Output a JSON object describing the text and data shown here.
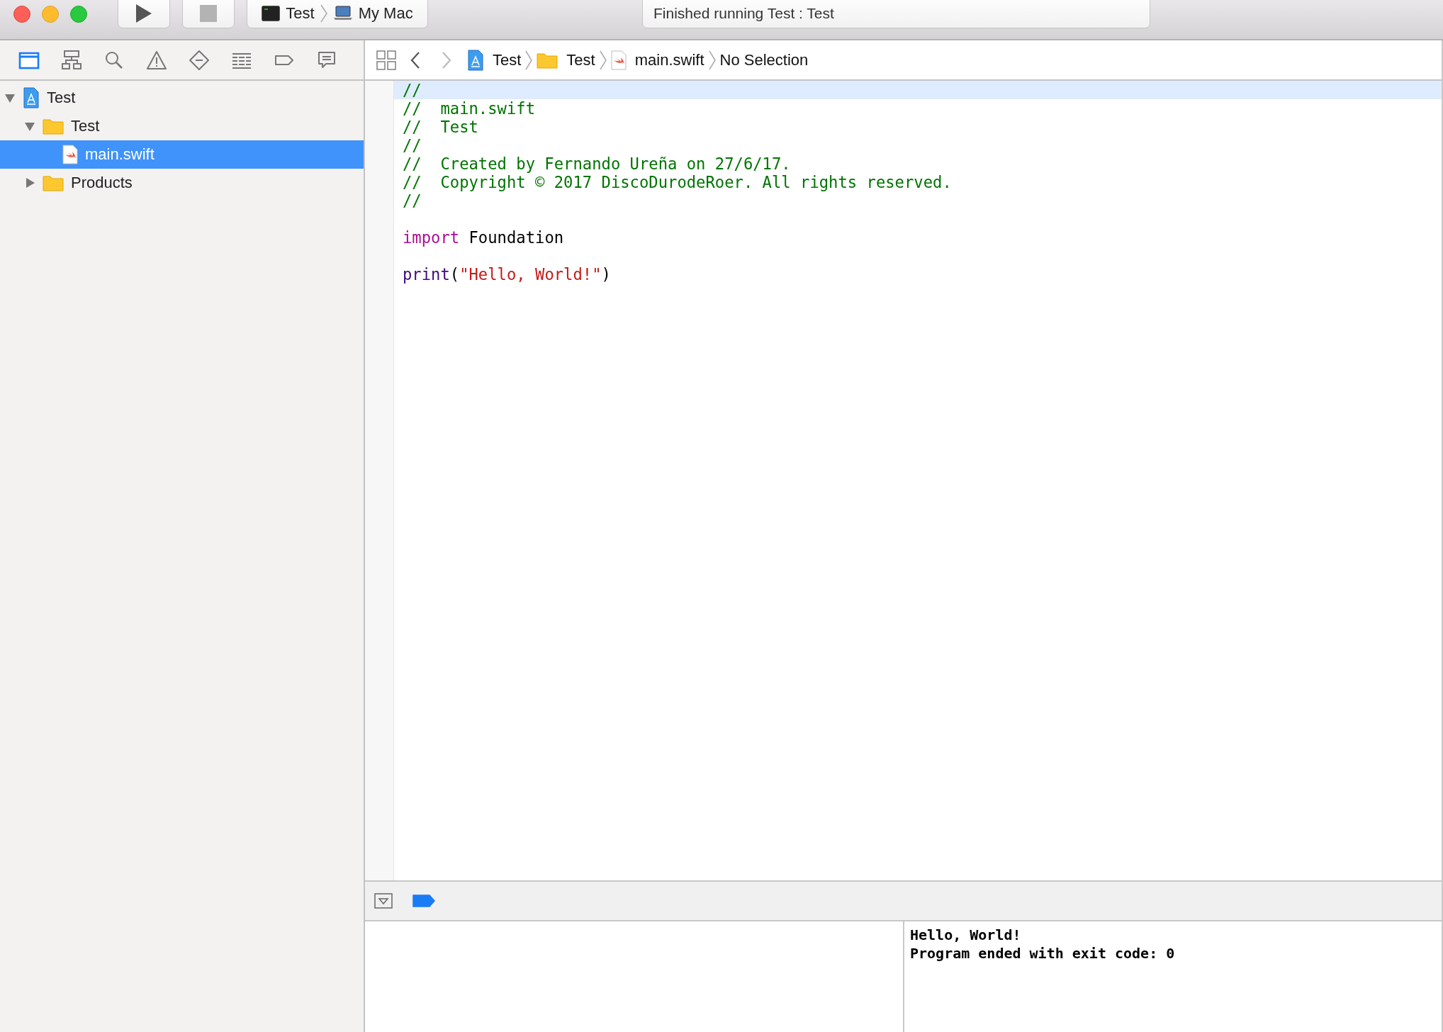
{
  "toolbar": {
    "scheme": {
      "target": "Test",
      "destination": "My Mac"
    },
    "activity": "Finished running Test : Test"
  },
  "navigator": {
    "tabs": [
      {
        "kind": "project",
        "selected": true
      },
      {
        "kind": "symbol",
        "selected": false
      },
      {
        "kind": "find",
        "selected": false
      },
      {
        "kind": "issue",
        "selected": false
      },
      {
        "kind": "test",
        "selected": false
      },
      {
        "kind": "debug",
        "selected": false
      },
      {
        "kind": "breakpoint",
        "selected": false
      },
      {
        "kind": "report",
        "selected": false
      }
    ],
    "tree": [
      {
        "label": "Test",
        "kind": "project",
        "expanded": true,
        "selected": false,
        "children": [
          {
            "label": "Test",
            "kind": "folder",
            "expanded": true,
            "selected": false,
            "children": [
              {
                "label": "main.swift",
                "kind": "swift",
                "selected": true
              }
            ]
          },
          {
            "label": "Products",
            "kind": "folder",
            "expanded": false,
            "selected": false
          }
        ]
      }
    ]
  },
  "jump_bar": {
    "path": [
      {
        "label": "Test",
        "kind": "project"
      },
      {
        "label": "Test",
        "kind": "folder"
      },
      {
        "label": "main.swift",
        "kind": "swift"
      },
      {
        "label": "No Selection",
        "kind": "none"
      }
    ]
  },
  "editor": {
    "lines": [
      {
        "current": true,
        "tokens": [
          {
            "kind": "comment",
            "text": "//"
          }
        ]
      },
      {
        "current": false,
        "tokens": [
          {
            "kind": "comment",
            "text": "//  main.swift"
          }
        ]
      },
      {
        "current": false,
        "tokens": [
          {
            "kind": "comment",
            "text": "//  Test"
          }
        ]
      },
      {
        "current": false,
        "tokens": [
          {
            "kind": "comment",
            "text": "//"
          }
        ]
      },
      {
        "current": false,
        "tokens": [
          {
            "kind": "comment",
            "text": "//  Created by Fernando Ureña on 27/6/17."
          }
        ]
      },
      {
        "current": false,
        "tokens": [
          {
            "kind": "comment",
            "text": "//  Copyright © 2017 DiscoDurodeRoer. All rights reserved."
          }
        ]
      },
      {
        "current": false,
        "tokens": [
          {
            "kind": "comment",
            "text": "//"
          }
        ]
      },
      {
        "current": false
      },
      {
        "current": false,
        "tokens": [
          {
            "kind": "keyword",
            "text": "import"
          },
          {
            "kind": "plain",
            "text": " Foundation"
          }
        ]
      },
      {
        "current": false
      },
      {
        "current": false,
        "tokens": [
          {
            "kind": "function",
            "text": "print"
          },
          {
            "kind": "plain",
            "text": "("
          },
          {
            "kind": "string",
            "text": "\"Hello, World!\""
          },
          {
            "kind": "plain",
            "text": ")"
          }
        ]
      }
    ]
  },
  "debug": {
    "breakpoints_active": true,
    "console": [
      "Hello, World!",
      "Program ended with exit code: 0"
    ]
  }
}
